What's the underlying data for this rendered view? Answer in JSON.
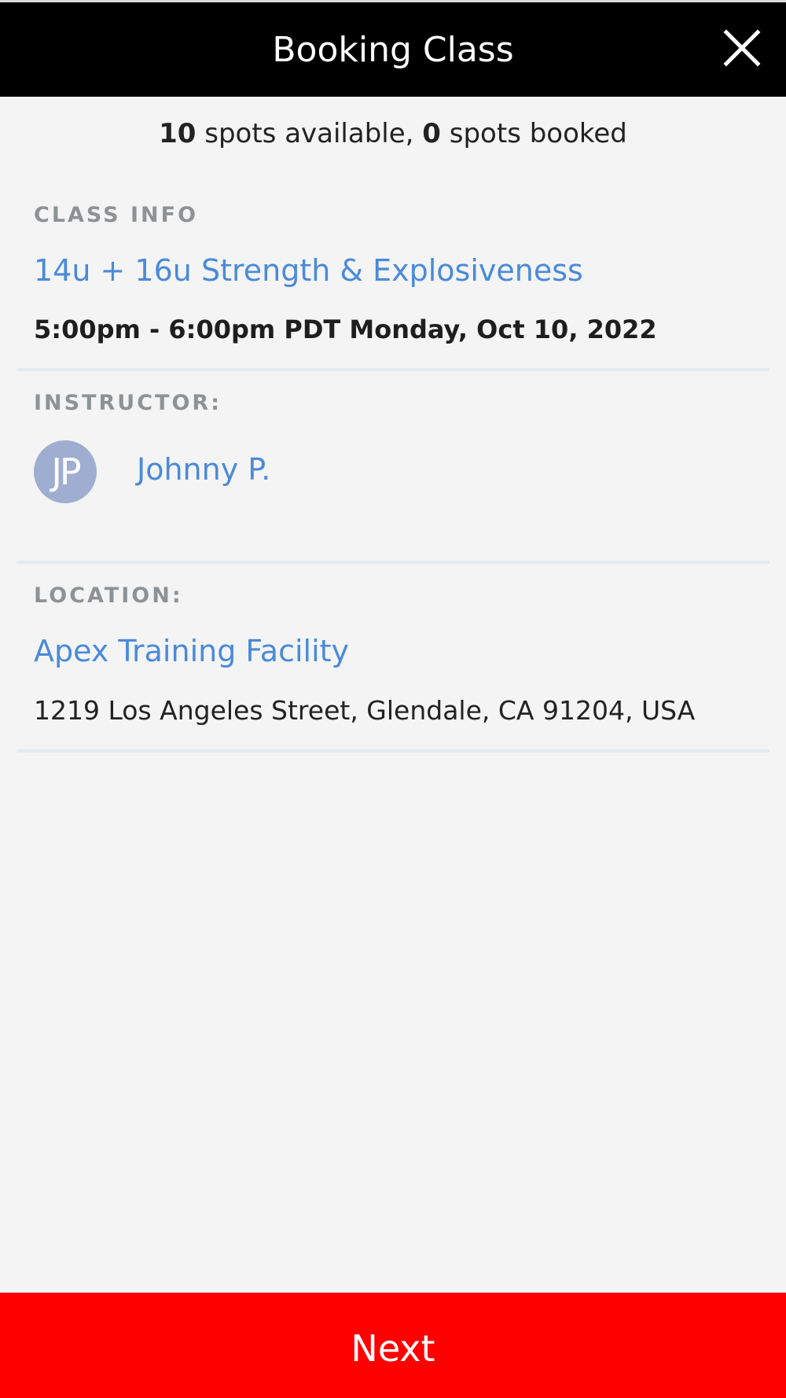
{
  "header": {
    "title": "Booking Class",
    "close_icon": "close-icon"
  },
  "availability": {
    "spots_available": "10",
    "spots_available_text": " spots available, ",
    "spots_booked": "0",
    "spots_booked_text": " spots booked"
  },
  "class_info": {
    "label": "CLASS INFO",
    "class_name": "14u + 16u Strength & Explosiveness",
    "time": "5:00pm - 6:00pm PDT Monday, Oct 10, 2022"
  },
  "instructor": {
    "label": "INSTRUCTOR:",
    "initials": "JP",
    "name": "Johnny P."
  },
  "location": {
    "label": "LOCATION:",
    "name": "Apex Training Facility",
    "address": "1219 Los Angeles Street, Glendale, CA 91204, USA"
  },
  "footer": {
    "next_label": "Next"
  },
  "colors": {
    "header_bg": "#000000",
    "accent_link": "#4a8ad9",
    "next_button": "#ff0000",
    "avatar_bg": "#9fadd0",
    "page_bg": "#f4f4f4"
  }
}
